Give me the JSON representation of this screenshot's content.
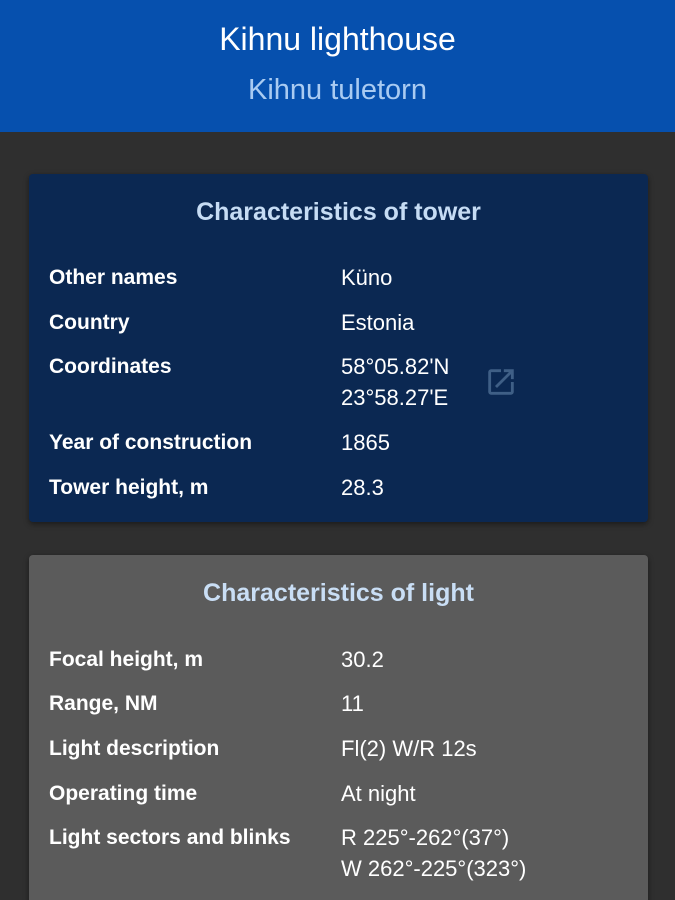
{
  "header": {
    "title": "Kihnu lighthouse",
    "subtitle": "Kihnu tuletorn"
  },
  "tower": {
    "heading": "Characteristics of tower",
    "rows": [
      {
        "label": "Other names",
        "value": "Küno"
      },
      {
        "label": "Country",
        "value": "Estonia"
      },
      {
        "label": "Coordinates",
        "value": "58°05.82'N",
        "value2": "23°58.27'E"
      },
      {
        "label": "Year of construction",
        "value": "1865"
      },
      {
        "label": "Tower height, m",
        "value": "28.3"
      }
    ],
    "coordinates_link_icon": "open-in-new-icon"
  },
  "light": {
    "heading": "Characteristics of light",
    "rows": [
      {
        "label": "Focal height, m",
        "value": "30.2"
      },
      {
        "label": "Range, NM",
        "value": "11"
      },
      {
        "label": "Light description",
        "value": "Fl(2) W/R 12s"
      },
      {
        "label": "Operating time",
        "value": "At night"
      },
      {
        "label": "Light sectors and blinks",
        "value": "R 225°-262°(37°)",
        "value2": "W 262°-225°(323°)"
      }
    ]
  },
  "colors": {
    "header_bg": "#0650ae",
    "tower_card_bg": "#0b2852",
    "light_card_bg": "#5b5b5b",
    "page_bg": "#2f2f2f"
  }
}
